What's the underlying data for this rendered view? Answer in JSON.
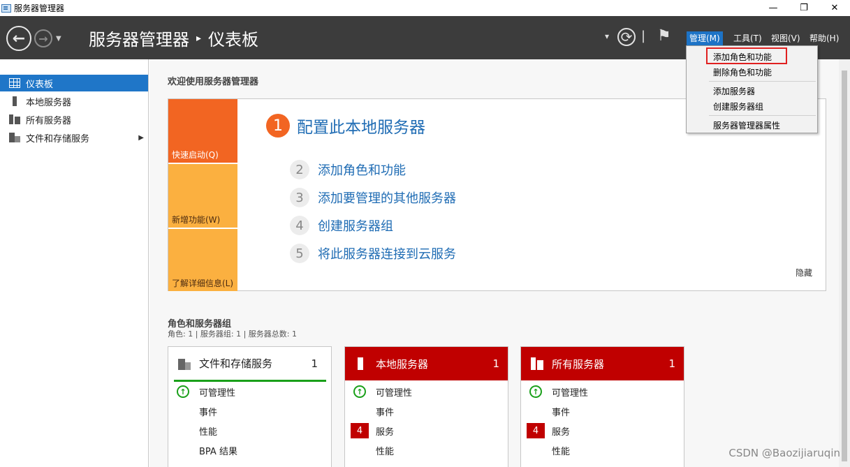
{
  "window": {
    "title": "服务器管理器",
    "minimize": "—",
    "restore": "❐",
    "close": "✕"
  },
  "header": {
    "back_glyph": "←",
    "forward_glyph": "→",
    "nav_dropdown_glyph": "▼",
    "breadcrumb_root": "服务器管理器",
    "breadcrumb_sep": "▸",
    "breadcrumb_page": "仪表板",
    "refresh_dropdown_glyph": "▾",
    "refresh_glyph": "⟳",
    "divider_glyph": "|",
    "flag_glyph": "⚑",
    "menus": [
      "管理(M)",
      "工具(T)",
      "视图(V)",
      "帮助(H)"
    ]
  },
  "sidebar": {
    "items": [
      {
        "label": "仪表板",
        "icon": "dashboard-icon"
      },
      {
        "label": "本地服务器",
        "icon": "server-icon"
      },
      {
        "label": "所有服务器",
        "icon": "servers-icon"
      },
      {
        "label": "文件和存储服务",
        "icon": "files-icon",
        "expand": "▶"
      }
    ]
  },
  "welcome": {
    "title": "欢迎使用服务器管理器",
    "tiles": [
      "快速启动(Q)",
      "新增功能(W)",
      "了解详细信息(L)"
    ],
    "step1": {
      "num": "1",
      "label": "配置此本地服务器"
    },
    "steps": [
      {
        "num": "2",
        "label": "添加角色和功能"
      },
      {
        "num": "3",
        "label": "添加要管理的其他服务器"
      },
      {
        "num": "4",
        "label": "创建服务器组"
      },
      {
        "num": "5",
        "label": "将此服务器连接到云服务"
      }
    ],
    "hide": "隐藏"
  },
  "roles": {
    "title": "角色和服务器组",
    "subtitle": "角色: 1 | 服务器组: 1 | 服务器总数: 1",
    "cards": [
      {
        "name": "文件和存储服务",
        "count": "1",
        "rows": [
          {
            "label": "可管理性",
            "badge": "ok"
          },
          {
            "label": "事件",
            "badge": ""
          },
          {
            "label": "性能",
            "badge": ""
          },
          {
            "label": "BPA 结果",
            "badge": ""
          }
        ]
      },
      {
        "name": "本地服务器",
        "count": "1",
        "rows": [
          {
            "label": "可管理性",
            "badge": "ok"
          },
          {
            "label": "事件",
            "badge": ""
          },
          {
            "label": "服务",
            "badge": "4"
          },
          {
            "label": "性能",
            "badge": ""
          }
        ]
      },
      {
        "name": "所有服务器",
        "count": "1",
        "rows": [
          {
            "label": "可管理性",
            "badge": "ok"
          },
          {
            "label": "事件",
            "badge": ""
          },
          {
            "label": "服务",
            "badge": "4"
          },
          {
            "label": "性能",
            "badge": ""
          }
        ]
      }
    ],
    "ok_glyph": "↑"
  },
  "manage_menu": {
    "items": [
      "添加角色和功能",
      "删除角色和功能",
      "添加服务器",
      "创建服务器组",
      "服务器管理器属性"
    ]
  },
  "watermark": "CSDN @Baozijiaruqin",
  "colors": {
    "header_bg": "#3c3c3c",
    "accent_blue": "#1f76c8",
    "orange": "#f26522",
    "amber": "#fbb040",
    "red": "#c00000",
    "green": "#1aa01a"
  }
}
